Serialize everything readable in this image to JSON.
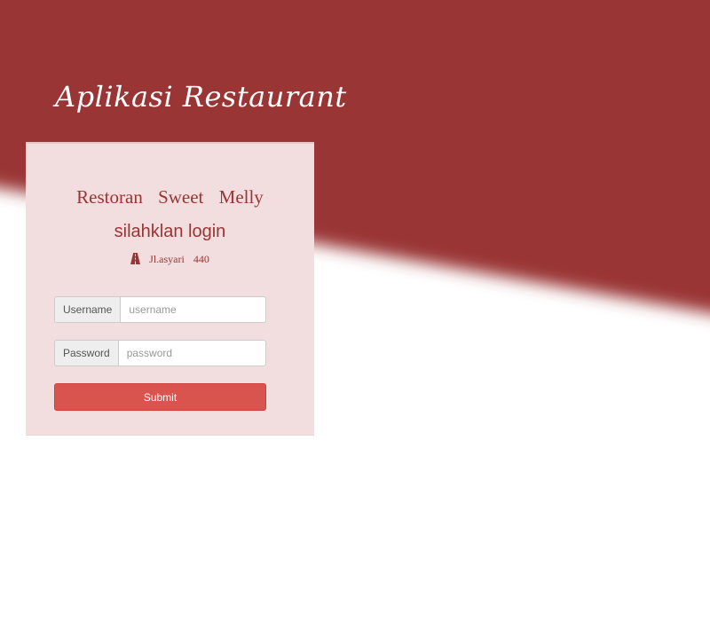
{
  "colors": {
    "band": "#9a3434",
    "card": "#f2dede",
    "accent_text": "#9a3535",
    "submit_button": "#d9534f"
  },
  "header": {
    "app_title": "Aplikasi Restaurant"
  },
  "login_card": {
    "restaurant_name": "Restoran Sweet Melly",
    "heading": "silahklan login",
    "address": {
      "icon": "road-icon",
      "street": "Jl.asyari",
      "number": "440"
    },
    "username": {
      "label": "Username",
      "placeholder": "username",
      "value": ""
    },
    "password": {
      "label": "Password",
      "placeholder": "password",
      "value": ""
    },
    "submit_label": "Submit"
  }
}
